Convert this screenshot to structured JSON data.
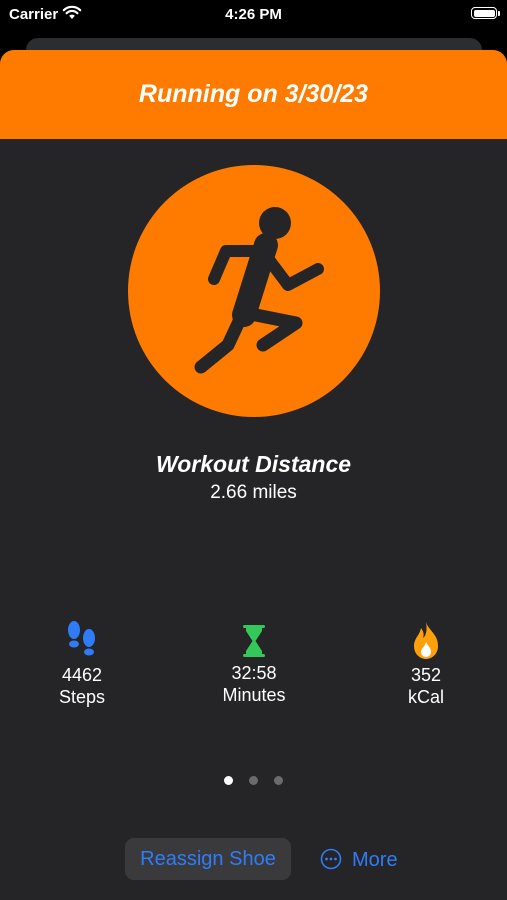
{
  "status_bar": {
    "carrier": "Carrier",
    "time": "4:26 PM"
  },
  "header": {
    "title": "Running on 3/30/23"
  },
  "hero": {
    "icon": "running-figure-icon",
    "color": "#ff7b00"
  },
  "metric": {
    "title": "Workout Distance",
    "value": "2.66 miles"
  },
  "stats": [
    {
      "icon": "footprints-icon",
      "value": "4462",
      "unit": "Steps",
      "color": "#2f7cf6"
    },
    {
      "icon": "hourglass-icon",
      "value": "32:58",
      "unit": "Minutes",
      "color": "#34c759"
    },
    {
      "icon": "flame-icon",
      "value": "352",
      "unit": "kCal",
      "color": "#ff9f0a"
    }
  ],
  "pager": {
    "count": 3,
    "active": 1
  },
  "actions": {
    "reassign_label": "Reassign Shoe",
    "more_label": "More"
  },
  "colors": {
    "accent": "#ff7b00",
    "link": "#2f7cf6",
    "background": "#252527"
  }
}
